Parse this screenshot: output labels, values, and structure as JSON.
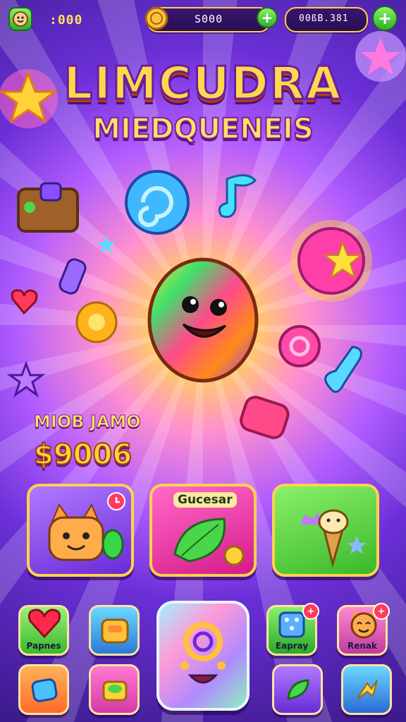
{
  "hud": {
    "lives_value": ":000",
    "coins_value": "S000",
    "gems_value": "00ßB.381",
    "avatar_icon": "player-face-icon",
    "coin_icon": "coin-icon",
    "add_icon": "plus-icon"
  },
  "title": {
    "main": "LIMCUDRA",
    "sub": "MIEDQUENEIS"
  },
  "game": {
    "label": "MIOB JAMO",
    "value": "$9006"
  },
  "cards": [
    {
      "label": "",
      "icon": "cat-character-icon",
      "badge_icon": "timer-icon",
      "color": "#7a3ad6"
    },
    {
      "label": "Gucesar",
      "icon": "leaf-icon",
      "color": "#e83aa8"
    },
    {
      "label": "",
      "icon": "ice-cream-icon",
      "color": "#5cd63a"
    }
  ],
  "bottom_buttons": [
    {
      "label": "Papnes",
      "icon": "heart-icon"
    },
    {
      "label": "",
      "icon": "candy-box-icon"
    },
    {
      "label": "Eapray",
      "icon": "dice-icon",
      "badge": "+"
    },
    {
      "label": "Renak",
      "icon": "cat-face-icon",
      "badge": "+"
    },
    {
      "label": "",
      "icon": "blue-gem-icon"
    },
    {
      "label": "",
      "icon": "treasure-icon"
    },
    {
      "label": "",
      "icon": "green-gem-icon"
    },
    {
      "label": "",
      "icon": "lightning-icon"
    }
  ],
  "center_button": {
    "icon": "smiley-play-icon"
  },
  "colors": {
    "accent_gold": "#ffd34a",
    "accent_green": "#2fae2a",
    "background_purple": "#6a2fd6"
  }
}
